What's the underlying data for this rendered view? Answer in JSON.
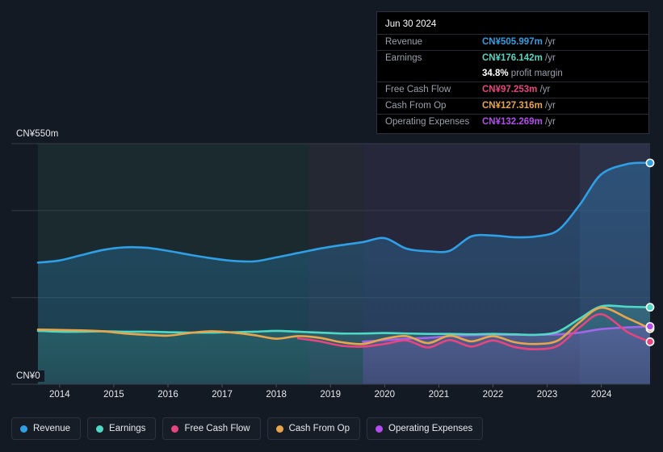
{
  "chart_data": {
    "type": "area",
    "title": "",
    "xlabel": "",
    "ylabel": "",
    "currency": "CN¥",
    "unit": "m",
    "ylim": [
      0,
      550
    ],
    "y_ticks": [
      {
        "label": "CN¥550m",
        "value": 550
      },
      {
        "label": "CN¥0",
        "value": 0
      }
    ],
    "gridlines": [
      550,
      397,
      198,
      0
    ],
    "grid": true,
    "legend_position": "bottom",
    "x_tick_labels": [
      "2014",
      "2015",
      "2016",
      "2017",
      "2018",
      "2019",
      "2020",
      "2021",
      "2022",
      "2023",
      "2024"
    ],
    "x": [
      2013.6,
      2014.0,
      2014.4,
      2014.8,
      2015.2,
      2015.6,
      2016.0,
      2016.4,
      2016.8,
      2017.2,
      2017.6,
      2018.0,
      2018.4,
      2018.8,
      2019.2,
      2019.6,
      2020.0,
      2020.4,
      2020.8,
      2021.2,
      2021.6,
      2022.0,
      2022.4,
      2022.8,
      2023.2,
      2023.6,
      2024.0,
      2024.5,
      2024.9
    ],
    "series": [
      {
        "name": "Revenue",
        "color": "#2f9fe6",
        "values": [
          278,
          283,
          295,
          307,
          313,
          312,
          305,
          296,
          288,
          282,
          281,
          290,
          300,
          310,
          318,
          325,
          334,
          310,
          304,
          305,
          338,
          340,
          336,
          338,
          352,
          410,
          480,
          504,
          506
        ],
        "end_value": 505.997,
        "end_label": "CN¥505.997m"
      },
      {
        "name": "Earnings",
        "color": "#4fd9c4",
        "values": [
          122,
          120,
          120,
          121,
          120,
          120,
          119,
          118,
          118,
          119,
          120,
          122,
          120,
          118,
          116,
          116,
          117,
          116,
          115,
          115,
          114,
          115,
          114,
          113,
          120,
          150,
          178,
          177,
          176
        ],
        "end_value": 176.142,
        "end_label": "CN¥176.142m"
      },
      {
        "name": "Free Cash Flow",
        "color": "#e6457f",
        "values": [
          null,
          null,
          null,
          null,
          null,
          null,
          null,
          null,
          null,
          null,
          null,
          null,
          105,
          98,
          88,
          86,
          92,
          100,
          84,
          101,
          86,
          100,
          85,
          80,
          88,
          130,
          160,
          118,
          97
        ],
        "end_value": 97.253,
        "end_label": "CN¥97.253m"
      },
      {
        "name": "Cash From Op",
        "color": "#e8a54b",
        "values": [
          125,
          124,
          123,
          121,
          116,
          113,
          111,
          117,
          121,
          118,
          112,
          104,
          110,
          106,
          96,
          92,
          104,
          110,
          94,
          111,
          98,
          110,
          96,
          92,
          100,
          142,
          175,
          150,
          127
        ],
        "end_value": 127.316,
        "end_label": "CN¥127.316m"
      },
      {
        "name": "Operating Expenses",
        "color": "#b44cf0",
        "values": [
          null,
          null,
          null,
          null,
          null,
          null,
          null,
          null,
          null,
          null,
          null,
          null,
          null,
          null,
          null,
          97,
          101,
          104,
          106,
          110,
          112,
          113,
          113,
          113,
          114,
          118,
          126,
          130,
          132
        ],
        "end_value": 132.269,
        "end_label": "CN¥132.269m"
      }
    ],
    "bands": [
      {
        "name": "past-green",
        "x_start": 2013.6,
        "x_end": 2018.6,
        "color": "#3d7a62"
      },
      {
        "name": "past-gray",
        "x_start": 2018.6,
        "x_end": 2019.6,
        "color": "#6e7380"
      },
      {
        "name": "past-purple",
        "x_start": 2019.6,
        "x_end": 2024.9,
        "color": "#8a6bb0"
      },
      {
        "name": "forecast",
        "x_start": 2023.6,
        "x_end": 2024.9,
        "color": "#1d3346"
      }
    ]
  },
  "tooltip": {
    "date": "Jun 30 2024",
    "rows": [
      {
        "label": "Revenue",
        "value": "CN¥505.997m",
        "unit": " /yr",
        "color": "#2f9fe6"
      },
      {
        "label": "Earnings",
        "value": "CN¥176.142m",
        "unit": " /yr",
        "color": "#4fd9c4"
      },
      {
        "label": "",
        "value": "34.8%",
        "unit": " profit margin",
        "color": "#ffffff"
      },
      {
        "label": "Free Cash Flow",
        "value": "CN¥97.253m",
        "unit": " /yr",
        "color": "#e6457f"
      },
      {
        "label": "Cash From Op",
        "value": "CN¥127.316m",
        "unit": " /yr",
        "color": "#e8a54b"
      },
      {
        "label": "Operating Expenses",
        "value": "CN¥132.269m",
        "unit": " /yr",
        "color": "#b44cf0"
      }
    ]
  },
  "legend": {
    "items": [
      {
        "label": "Revenue",
        "color": "#2f9fe6"
      },
      {
        "label": "Earnings",
        "color": "#4fd9c4"
      },
      {
        "label": "Free Cash Flow",
        "color": "#e6457f"
      },
      {
        "label": "Cash From Op",
        "color": "#e8a54b"
      },
      {
        "label": "Operating Expenses",
        "color": "#b44cf0"
      }
    ]
  },
  "axis": {
    "y_top_label": "CN¥550m",
    "y_bottom_label": "CN¥0"
  }
}
